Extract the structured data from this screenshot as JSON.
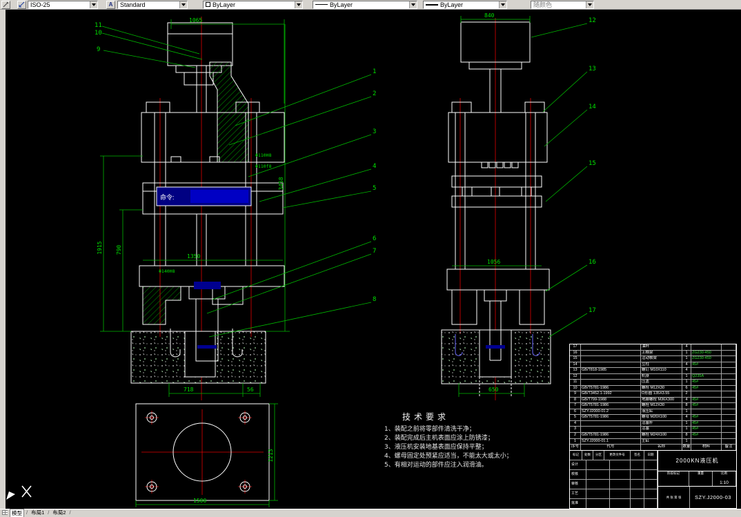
{
  "toolbar": {
    "dim_style": "ISO-25",
    "text_style": "Standard",
    "color": "ByLayer",
    "linetype": "ByLayer",
    "lineweight": "ByLayer",
    "plot_style": "随颜色",
    "text_style_icon_letter": "A"
  },
  "command_prompt": "命令:",
  "tabs": {
    "model": "模型",
    "layout1": "布局1",
    "layout2": "布局2"
  },
  "balloons": {
    "b1": "1",
    "b2": "2",
    "b3": "3",
    "b4": "4",
    "b5": "5",
    "b6": "6",
    "b7": "7",
    "b8": "8",
    "b9": "9",
    "b10": "10",
    "b11": "11",
    "b12": "12",
    "b13": "13",
    "b14": "14",
    "b15": "15",
    "b16": "16",
    "b17": "17"
  },
  "dims": {
    "top_width": "1065",
    "total_height": "3458",
    "height_outer": "1915",
    "height_inner": "790",
    "platen_width": "1350",
    "base_span": "718",
    "base_offset": "56",
    "plate_width": "1500",
    "plate_height": "1213",
    "cyl_width": "840",
    "table_width": "1056",
    "pit_width": "650",
    "bore_a": "Φ110H8",
    "bore_b": "Φ110f8",
    "bore_c": "Φ140H8"
  },
  "tech_requirements": {
    "title": "技术要求",
    "items": [
      "1、装配之前将零部件清洗干净；",
      "2、装配完成后主机表面应涂上防锈漆；",
      "3、液压机安装地基表面应保持平整；",
      "4、螺母固定处预紧应适当，不能太大或太小；",
      "5、有相对运动的部件应注入润滑油。"
    ]
  },
  "parts_table": {
    "headers": [
      "序号",
      "代号",
      "名称",
      "数量",
      "材料",
      "备注"
    ],
    "rows": [
      [
        "17",
        "",
        "油杯",
        "4",
        "",
        ""
      ],
      [
        "16",
        "",
        "上横梁",
        "1",
        "ZG230-450",
        ""
      ],
      [
        "15",
        "",
        "活动横梁",
        "1",
        "ZG230-450",
        ""
      ],
      [
        "14",
        "",
        "立柱",
        "4",
        "45#",
        ""
      ],
      [
        "13",
        "GB/T818-1985",
        "螺钉 M10X110",
        "4",
        "",
        ""
      ],
      [
        "12",
        "",
        "机身",
        "1",
        "Q235A",
        ""
      ],
      [
        "11",
        "",
        "压盖",
        "1",
        "45#",
        ""
      ],
      [
        "10",
        "GB/T5781-1986",
        "螺栓 M12X30",
        "6",
        "45#",
        ""
      ],
      [
        "9",
        "GB/T3452.1-1992",
        "O形圈 135X3.55",
        "2",
        "",
        ""
      ],
      [
        "8",
        "GB/T799-1988",
        "地脚螺栓 M36X300",
        "4",
        "45#",
        ""
      ],
      [
        "7",
        "GB/T5781-1986",
        "螺栓 M12X30",
        "8",
        "45#",
        ""
      ],
      [
        "6",
        "SZY.J2000-01.2",
        "液压缸",
        "1",
        "",
        ""
      ],
      [
        "5",
        "GB/T5781-1986",
        "螺母 M20X100",
        "4",
        "45#",
        ""
      ],
      [
        "4",
        "",
        "活塞杆",
        "1",
        "45#",
        ""
      ],
      [
        "3",
        "",
        "活塞",
        "1",
        "45#",
        ""
      ],
      [
        "2",
        "GB/T5781-1986",
        "螺栓 M24X100",
        "8",
        "45#",
        ""
      ],
      [
        "1",
        "SZY.J2000-01.1",
        "主缸",
        "1",
        "",
        ""
      ]
    ]
  },
  "title_block": {
    "product": "2000KN液压机",
    "drawing_no": "SZY.J2000-03",
    "scale_label": "比例",
    "scale_value": "1:10",
    "weight_label": "重量",
    "stage_label": "阶段标记",
    "sheet_label": "共 张 第 张",
    "sig_headers": [
      "标记",
      "处数",
      "分区",
      "更改文件号",
      "签名",
      "日期"
    ],
    "roles": [
      "设计",
      "校核",
      "审核",
      "工艺",
      "批准"
    ]
  }
}
